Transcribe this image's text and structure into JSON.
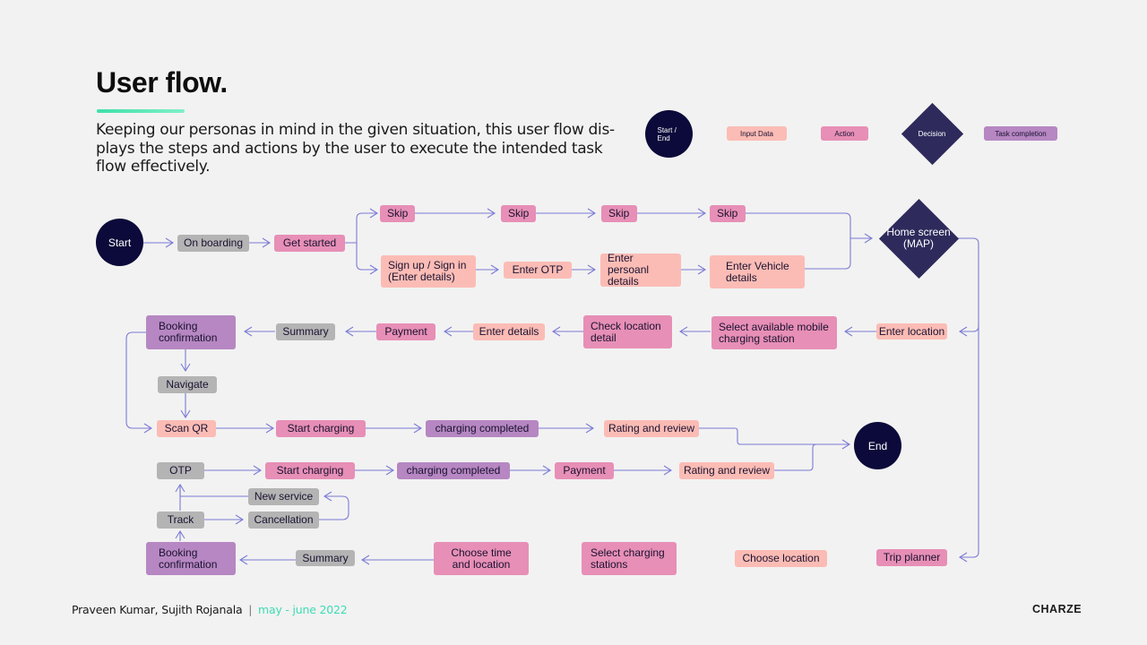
{
  "header": {
    "title": "User flow.",
    "description": "Keeping our personas in mind in the given situation, this user flow dis-plays the steps and actions by  the user to execute the intended task flow effectively.",
    "accent_color": "#3ee0a8"
  },
  "legend": {
    "start_end": "Start / End",
    "input_data": "Input Data",
    "action": "Action",
    "decision": "Decision",
    "task_completion": "Task completion"
  },
  "colors": {
    "start_end": "#0c0a3a",
    "input_data": "#fbbcb5",
    "action": "#e78fb6",
    "decision": "#2e2b5c",
    "task_completion": "#b687c2",
    "neutral": "#b4b4b4",
    "connector": "#7b7bd6"
  },
  "flow": {
    "start": "Start",
    "end": "End",
    "on_boarding": "On boarding",
    "get_started": "Get started",
    "skip_1": "Skip",
    "skip_2": "Skip",
    "skip_3": "Skip",
    "skip_4": "Skip",
    "sign_up": "Sign up / Sign in (Enter details)",
    "enter_otp": "Enter OTP",
    "enter_personal": "Enter persoanl details",
    "enter_vehicle": "Enter Vehicle details",
    "home_screen": "Home screen (MAP)",
    "enter_location": "Enter location",
    "select_mobile_station": "Select available mobile charging station",
    "check_location": "Check location detail",
    "enter_details": "Enter details",
    "payment_1": "Payment",
    "summary_1": "Summary",
    "booking_confirmation_1": "Booking confirmation",
    "navigate": "Navigate",
    "scan_qr": "Scan QR",
    "start_charging_1": "Start charging",
    "charging_completed_1": "charging completed",
    "rating_review_1": "Rating and review",
    "otp": "OTP",
    "start_charging_2": "Start charging",
    "charging_completed_2": "charging completed",
    "payment_2": "Payment",
    "rating_review_2": "Rating and review",
    "new_service": "New service",
    "cancellation": "Cancellation",
    "track": "Track",
    "booking_confirmation_2": "Booking confirmation",
    "summary_2": "Summary",
    "choose_time_location": "Choose time and location",
    "select_charging_stations": "Select charging stations",
    "choose_location": "Choose location",
    "trip_planner": "Trip planner"
  },
  "footer": {
    "authors": "Praveen Kumar, Sujith Rojanala",
    "separator": "|",
    "date": "may - june 2022",
    "brand": "CHARZE"
  }
}
